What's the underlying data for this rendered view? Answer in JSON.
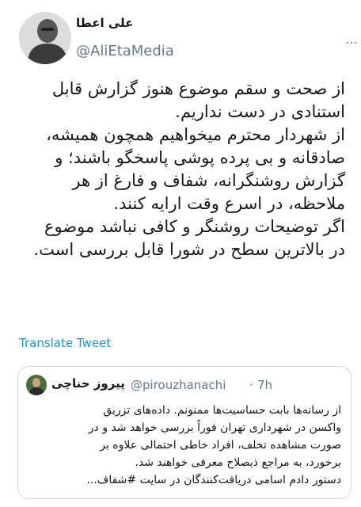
{
  "author": {
    "name": "علی اعطا",
    "handle": "@AliEtaMedia"
  },
  "tweet": {
    "lines": [
      "از صحت و سقم موضوع هنوز گزارش قابل",
      "استنادی در دست نداریم.",
      "از شهردار محترم میخواهیم همچون همیشه،",
      "صادقانه و بی پرده پوشی پاسخگو باشند؛ و",
      "گزارش روشنگرانه، شفاف و فارغ از هر",
      "ملاحظه، در اسرع وقت ارایه کنند.",
      "اگر توضیحات روشنگر و کافی نباشد موضوع",
      "در بالاترین سطح در شورا قابل بررسی است."
    ]
  },
  "translate_label": "Translate Tweet",
  "more_label": "⋯",
  "quote": {
    "name": "پیروز حناچی",
    "handle": "@pirouzhanachi",
    "separator": "·",
    "time": "7h",
    "lines": [
      "از رسانه‌ها بابت حساسیت‌ها ممنونم. داده‌های تزریق",
      "واکسن در شهرداری تهران فوراً بررسی خواهد شد و در",
      "صورت مشاهده تخلف، افراد خاطی احتمالی علاوه بر",
      "برخورد، به مراجع ذیصلاح معرفی خواهند شد.",
      "دستور دادم اسامی دریافت‌کنندگان در سایت #شفاف..."
    ]
  }
}
